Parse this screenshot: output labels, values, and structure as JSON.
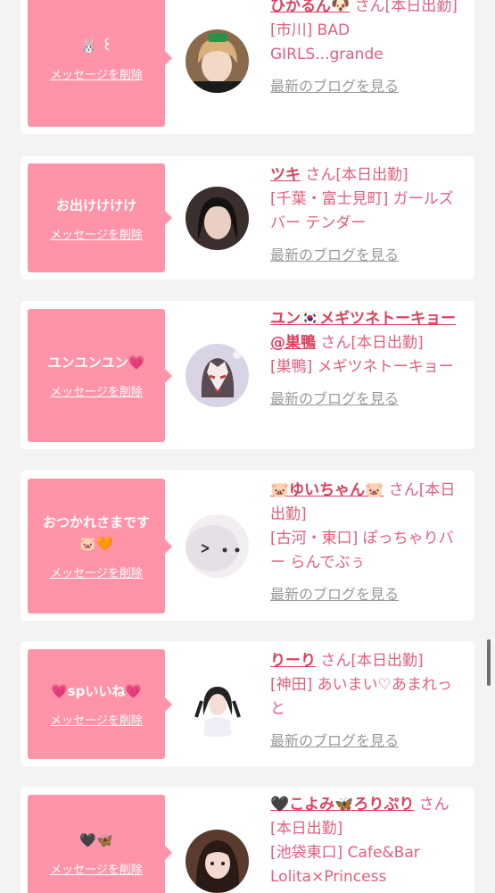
{
  "delete_label": "メッセージを削除",
  "blog_label": "最新のブログを見る",
  "items": [
    {
      "message": "🐰 ꒰ ",
      "name": "ひかるん🐶",
      "suffix": "さん[本日出勤]",
      "shop": "[市川] BAD GIRLS...grande"
    },
    {
      "message": "お出けけけけ",
      "name": "ツキ",
      "suffix": "さん[本日出勤]",
      "shop": "[千葉・富士見町] ガールズバー テンダー"
    },
    {
      "message": "ユンユンユン💗",
      "name": "ユン🇰🇷メギツネトーキョー@巣鴨",
      "suffix": "さん[本日出勤]",
      "shop": "[巣鴨] メギツネトーキョー"
    },
    {
      "message": "おつかれさまです🐷🧡",
      "name": "🐷ゆいちゃん🐷",
      "suffix": "さん[本日出勤]",
      "shop": "[古河・東口] ぽっちゃりバー らんでぶぅ"
    },
    {
      "message": "💗spいいね💗",
      "name": "りーり",
      "suffix": "さん[本日出勤]",
      "shop": "[神田] あいまい♡あまれっと"
    },
    {
      "message": "🖤🦋",
      "name": "🖤こよみ🦋ろりぷり",
      "suffix": "さん[本日出勤]",
      "shop": "[池袋東口] Cafe&Bar Lolita×Princess"
    }
  ]
}
